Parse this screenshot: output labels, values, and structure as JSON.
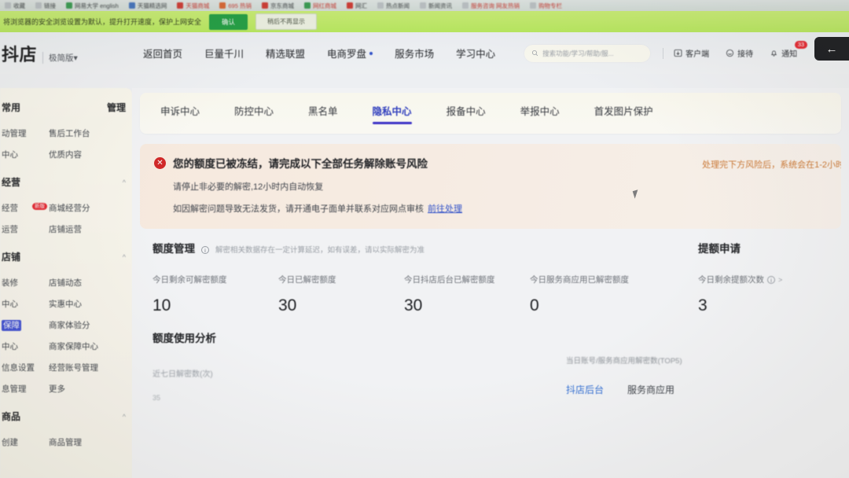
{
  "browser": {
    "bookmarks": [
      {
        "label": "收藏",
        "icon": "folder-icon",
        "color": "gray"
      },
      {
        "label": "链接",
        "icon": "page-icon",
        "color": "gray"
      },
      {
        "label": "网易大学 english",
        "icon": "globe-icon",
        "color": "green"
      },
      {
        "label": "天猫精选网",
        "icon": "cart-icon",
        "color": "blue"
      },
      {
        "label": "天猫商城",
        "icon": "tmall-icon",
        "color": "red"
      },
      {
        "label": "695 热销",
        "icon": "shop-icon",
        "color": "orange"
      },
      {
        "label": "京东商城",
        "icon": "jd-icon",
        "color": "red"
      },
      {
        "label": "网红商城",
        "icon": "star-icon",
        "color": "green"
      },
      {
        "label": "网汇",
        "icon": "bag-icon",
        "color": "red"
      },
      {
        "label": "热点新闻",
        "icon": "news-icon",
        "color": "gray"
      },
      {
        "label": "新闻资讯",
        "icon": "news-icon",
        "color": "gray"
      },
      {
        "label": "服务咨询 网友热销",
        "icon": "page-icon",
        "color": "gray"
      },
      {
        "label": "购物专栏",
        "icon": "page-icon",
        "color": "gray"
      }
    ],
    "notice": {
      "text": "将浏览器的安全浏览设置为默认，提升打开速度，保护上网安全",
      "confirm_label": "确认",
      "dismiss_label": "稍后不再显示"
    }
  },
  "header": {
    "logo": "抖店",
    "logo_sub": "极简版▾",
    "nav": [
      {
        "label": "返回首页",
        "dot": false
      },
      {
        "label": "巨量千川",
        "dot": false
      },
      {
        "label": "精选联盟",
        "dot": false
      },
      {
        "label": "电商罗盘",
        "dot": true
      },
      {
        "label": "服务市场",
        "dot": false
      },
      {
        "label": "学习中心",
        "dot": false
      }
    ],
    "search": {
      "placeholder": "搜索功能/学习/帮助/服...",
      "icon": "search-icon"
    },
    "actions": [
      {
        "label": "客户端",
        "icon": "download-icon",
        "badge": ""
      },
      {
        "label": "接待",
        "icon": "headset-icon",
        "badge": ""
      },
      {
        "label": "通知",
        "icon": "bell-icon",
        "badge": "33"
      }
    ],
    "back_button": {
      "icon": "arrow-left-icon",
      "label": "←"
    }
  },
  "sidebar": {
    "groups": [
      {
        "title_left": "常用",
        "title_right": "管理",
        "rows": [
          {
            "left": "动管理",
            "right": "售后工作台",
            "hot": false,
            "selected": false
          },
          {
            "left": "中心",
            "right": "优质内容",
            "hot": false,
            "selected": false
          }
        ]
      },
      {
        "title_left": "经营",
        "title_right": "",
        "caret": "^",
        "rows": [
          {
            "left": "经营",
            "right": "商城经营分",
            "hot": true,
            "hot_label": "新版",
            "selected": false
          },
          {
            "left": "运营",
            "right": "店铺运营",
            "hot": false,
            "selected": false
          }
        ]
      },
      {
        "title_left": "店铺",
        "title_right": "",
        "caret": "^",
        "rows": [
          {
            "left": "装修",
            "right": "店铺动态",
            "hot": false,
            "selected": false
          },
          {
            "left": "中心",
            "right": "实惠中心",
            "hot": false,
            "selected": false
          },
          {
            "left": "保障",
            "right": "商家体验分",
            "hot": false,
            "selected": true
          },
          {
            "left": "中心",
            "right": "商家保障中心",
            "hot": false,
            "selected": false
          },
          {
            "left": "信息设置",
            "right": "经营账号管理",
            "hot": false,
            "selected": false
          },
          {
            "left": "息管理",
            "right": "更多",
            "hot": false,
            "selected": false
          }
        ]
      },
      {
        "title_left": "商品",
        "title_right": "",
        "caret": "^",
        "rows": [
          {
            "left": "创建",
            "right": "商品管理",
            "hot": false,
            "selected": false
          }
        ]
      }
    ]
  },
  "main": {
    "tabs": [
      {
        "label": "申诉中心",
        "active": false
      },
      {
        "label": "防控中心",
        "active": false
      },
      {
        "label": "黑名单",
        "active": false
      },
      {
        "label": "隐私中心",
        "active": true
      },
      {
        "label": "报备中心",
        "active": false
      },
      {
        "label": "举报中心",
        "active": false
      },
      {
        "label": "首发图片保护",
        "active": false
      }
    ],
    "alert": {
      "icon": "error-circle-icon",
      "title": "您的额度已被冻结，请完成以下全部任务解除账号风险",
      "line1": "请停止非必要的解密,12小时内自动恢复",
      "line2": "如因解密问题导致无法发货，请开通电子面单并联系对应网点审核",
      "link": "前往处理",
      "right_note": "处理完下方风险后，系统会在1-2小时"
    },
    "quota": {
      "title": "额度管理",
      "info_icon": "info-icon",
      "hint": "解密相关数据存在一定计算延迟，如有误差，请以实际解密为准",
      "stats": [
        {
          "label": "今日剩余可解密额度",
          "value": "10",
          "has_info": false,
          "has_chevron": false
        },
        {
          "label": "今日已解密额度",
          "value": "30",
          "has_info": false,
          "has_chevron": false
        },
        {
          "label": "今日抖店后台已解密额度",
          "value": "30",
          "has_info": false,
          "has_chevron": false
        },
        {
          "label": "今日服务商应用已解密额度",
          "value": "0",
          "has_info": false,
          "has_chevron": false
        }
      ],
      "apply": {
        "title": "提额申请",
        "stat": {
          "label": "今日剩余提额次数",
          "value": "3",
          "info_icon": "info-icon",
          "chevron": ">"
        }
      }
    },
    "analysis": {
      "title": "额度使用分析",
      "chart_label": "近七日解密数(次)",
      "y_tick": "35",
      "right_title": "当日账号/服务商应用解密数(TOP5)",
      "right_tabs": [
        {
          "label": "抖店后台",
          "active": true
        },
        {
          "label": "服务商应用",
          "active": false
        }
      ]
    }
  },
  "colors": {
    "accent_blue": "#2b3ccc",
    "alert_red": "#e02020",
    "warn_orange": "#d4762a",
    "badge_red": "#f5222d",
    "banner_green": "#b6ec52"
  }
}
